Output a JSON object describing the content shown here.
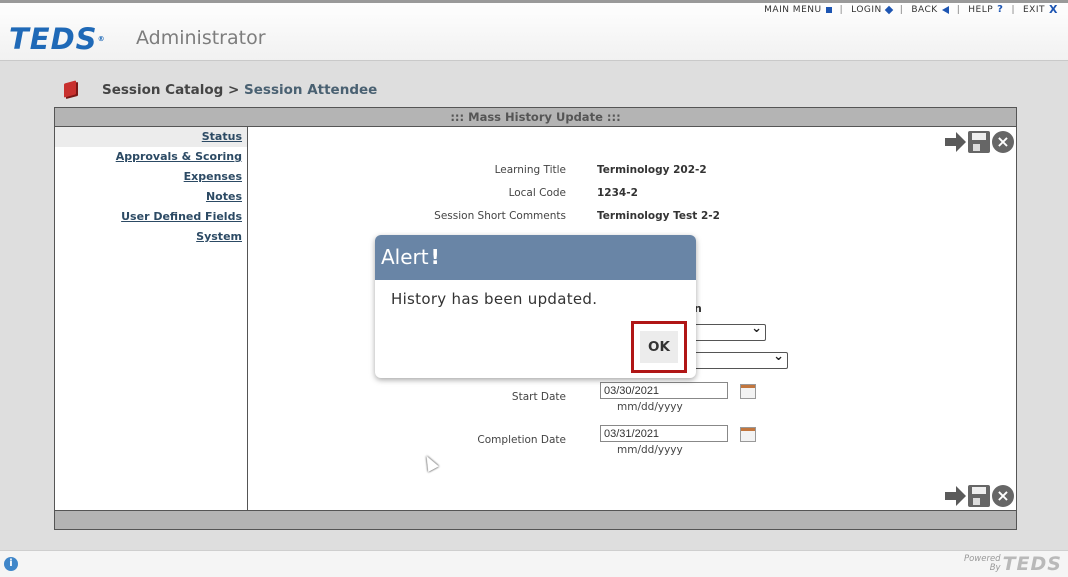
{
  "top_menu": {
    "main_menu": "MAIN MENU",
    "login": "LOGIN",
    "back": "BACK",
    "help": "HELP",
    "exit": "EXIT"
  },
  "brand": {
    "logo": "TEDS",
    "reg": "®",
    "app_name": "Administrator"
  },
  "breadcrumb": {
    "parent": "Session Catalog",
    "separator": ">",
    "current": "Session Attendee"
  },
  "panel": {
    "title": "::: Mass History Update :::"
  },
  "left_nav": {
    "items": [
      {
        "label": "Status"
      },
      {
        "label": "Approvals & Scoring"
      },
      {
        "label": "Expenses"
      },
      {
        "label": "Notes"
      },
      {
        "label": "User Defined Fields"
      },
      {
        "label": "System"
      }
    ]
  },
  "form": {
    "learning_title_label": "Learning Title",
    "learning_title_value": "Terminology 202-2",
    "local_code_label": "Local Code",
    "local_code_value": "1234-2",
    "session_comments_label": "Session Short Comments",
    "session_comments_value": "Terminology Test 2-2",
    "start_date_label": "Start Date",
    "start_date_value": "03/30/2021",
    "start_date_hint": "mm/dd/yyyy",
    "completion_date_label": "Completion Date",
    "completion_date_value": "03/31/2021",
    "completion_date_hint": "mm/dd/yyyy"
  },
  "alert": {
    "title": "Alert",
    "bang": "!",
    "message": "History has been updated.",
    "ok_label": "OK"
  },
  "footer": {
    "powered": "Powered",
    "by": "By",
    "logo": "TEDS"
  },
  "colors": {
    "brand_blue": "#1f69b7",
    "alert_header": "#6985a6",
    "highlight_red": "#b01616"
  }
}
